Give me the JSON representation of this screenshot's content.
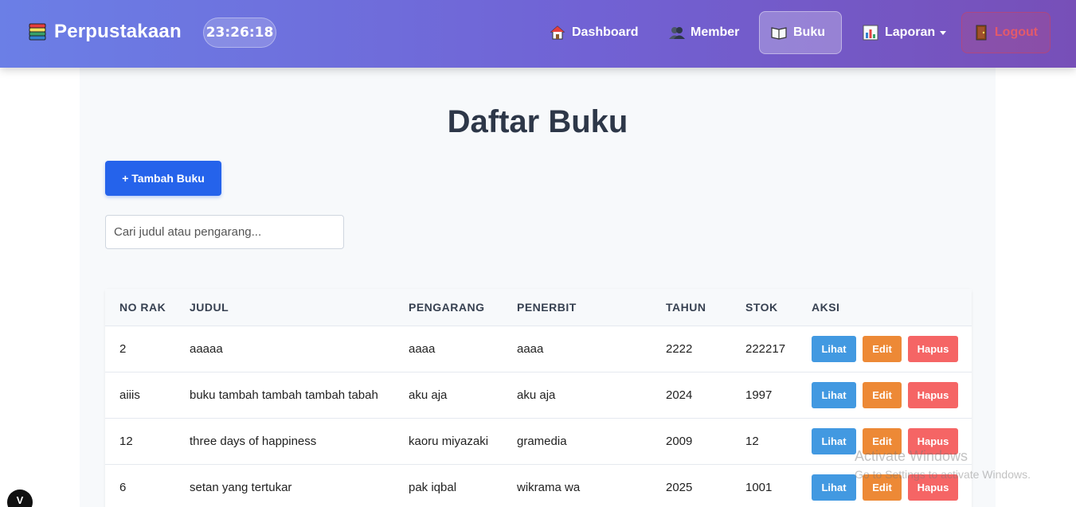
{
  "header": {
    "brand": "Perpustakaan",
    "clock": "23:26:18",
    "nav": [
      {
        "label": "Dashboard",
        "icon": "house-icon"
      },
      {
        "label": "Member",
        "icon": "users-icon"
      },
      {
        "label": "Buku",
        "icon": "book-icon",
        "active": true
      },
      {
        "label": "Laporan",
        "icon": "chart-icon",
        "dropdown": true
      }
    ],
    "logout_label": "Logout"
  },
  "main": {
    "title": "Daftar Buku",
    "add_button": "+ Tambah Buku",
    "search_placeholder": "Cari judul atau pengarang...",
    "columns": [
      "NO RAK",
      "JUDUL",
      "PENGARANG",
      "PENERBIT",
      "TAHUN",
      "STOK",
      "AKSI"
    ],
    "rows": [
      {
        "rak": "2",
        "judul": "aaaaa",
        "pengarang": "aaaa",
        "penerbit": "aaaa",
        "tahun": "2222",
        "stok": "222217"
      },
      {
        "rak": "aiiis",
        "judul": "buku tambah tambah tambah tabah",
        "pengarang": "aku aja",
        "penerbit": "aku aja",
        "tahun": "2024",
        "stok": "1997"
      },
      {
        "rak": "12",
        "judul": "three days of happiness",
        "pengarang": "kaoru miyazaki",
        "penerbit": "gramedia",
        "tahun": "2009",
        "stok": "12"
      },
      {
        "rak": "6",
        "judul": "setan yang tertukar",
        "pengarang": "pak iqbal",
        "penerbit": "wikrama wa",
        "tahun": "2025",
        "stok": "1001"
      }
    ],
    "actions": {
      "view": "Lihat",
      "edit": "Edit",
      "delete": "Hapus"
    }
  },
  "overlay": {
    "watermark_title": "Activate Windows",
    "watermark_sub": "Go to Settings to activate Windows.",
    "corner_badge": "V"
  },
  "colors": {
    "primary": "#2563eb",
    "view": "#4299e1",
    "edit": "#ed8936",
    "delete": "#f56565"
  }
}
